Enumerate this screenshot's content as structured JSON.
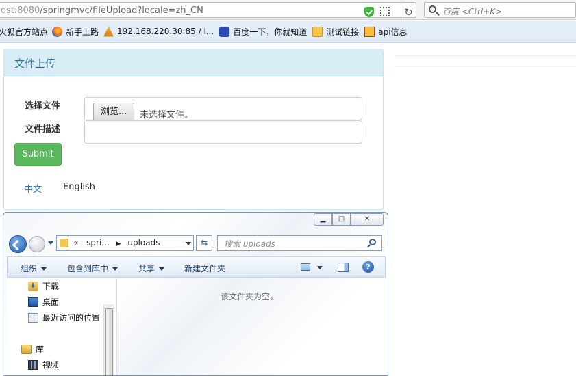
{
  "browser": {
    "url_host": "ost:8080",
    "url_path": "/springmvc/fileUpload?locale=zh_CN",
    "search_placeholder": "百度 <Ctrl+K>",
    "reload_glyph": "↻"
  },
  "bookmarks": [
    {
      "label": "火狐官方站点",
      "icon": "none"
    },
    {
      "label": "新手上路",
      "icon": "firefox-icon"
    },
    {
      "label": "192.168.220.30:85 / l...",
      "icon": "phpmyadmin-icon"
    },
    {
      "label": "百度一下，你就知道",
      "icon": "baidu-paw-icon"
    },
    {
      "label": "测试链接",
      "icon": "folder-icon"
    },
    {
      "label": "api信息",
      "icon": "api-icon"
    }
  ],
  "panel": {
    "title": "文件上传",
    "file_label": "选择文件",
    "browse_label": "浏览...",
    "no_file_text": "未选择文件。",
    "desc_label": "文件描述",
    "desc_value": "",
    "submit_label": "Submit",
    "lang_zh": "中文",
    "lang_en": "English",
    "colors": {
      "heading_bg": "#d9edf7",
      "heading_text": "#31708f",
      "submit_bg": "#5cb85c",
      "link": "#337ab7"
    }
  },
  "explorer": {
    "win_minimize": "▁",
    "win_restore": "□",
    "win_close": "✕",
    "address_prefix": "«",
    "address_crumbs": [
      "spri...",
      "uploads"
    ],
    "refresh_glyph": "⇆",
    "search_placeholder": "搜索 uploads",
    "toolbar": {
      "organize": "组织",
      "include_library": "包含到库中",
      "share": "共享",
      "new_folder": "新建文件夹",
      "help": "?"
    },
    "nav": [
      "下载",
      "桌面",
      "最近访问的位置",
      "库",
      "视频"
    ],
    "empty_message": "该文件夹为空。"
  }
}
